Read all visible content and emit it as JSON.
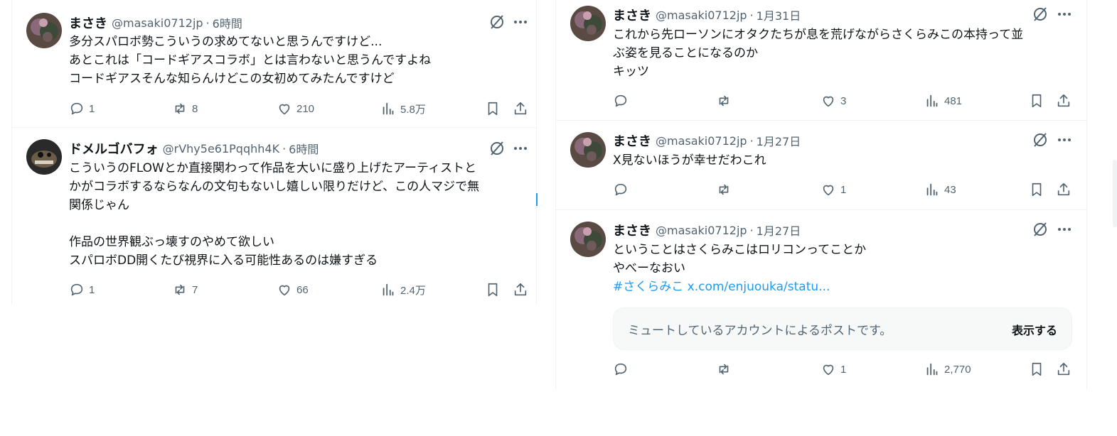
{
  "left_tweets": [
    {
      "name": "まさき",
      "handle": "@masaki0712jp",
      "sep": "·",
      "time": "6時間",
      "lines": [
        "多分スパロボ勢こういうの求めてないと思うんですけど...",
        "あとこれは「コードギアスコラボ」とは言わないと思うんですよね",
        "コードギアスそんな知らんけどこの女初めてみたんですけど"
      ],
      "replies": "1",
      "reposts": "8",
      "likes": "210",
      "views": "5.8万"
    },
    {
      "name": "ドメルゴバフォ",
      "handle": "@rVhy5e61Pqqhh4K",
      "sep": "·",
      "time": "6時間",
      "lines": [
        "こういうのFLOWとか直接関わって作品を大いに盛り上げたアーティストと",
        "かがコラボするならなんの文句もないし嬉しい限りだけど、この人マジで無",
        "関係じゃん",
        "",
        "作品の世界観ぶっ壊すのやめて欲しい",
        "スパロボDD開くたび視界に入る可能性あるのは嫌すぎる"
      ],
      "replies": "1",
      "reposts": "7",
      "likes": "66",
      "views": "2.4万"
    }
  ],
  "right_tweets": [
    {
      "name": "まさき",
      "handle": "@masaki0712jp",
      "sep": "·",
      "time": "1月31日",
      "lines": [
        "これから先ローソンにオタクたちが息を荒げながらさくらみこの本持って並",
        "ぶ姿を見ることになるのか",
        "キッツ"
      ],
      "replies": "",
      "reposts": "",
      "likes": "3",
      "views": "481"
    },
    {
      "name": "まさき",
      "handle": "@masaki0712jp",
      "sep": "·",
      "time": "1月27日",
      "lines": [
        "X見ないほうが幸せだわこれ"
      ],
      "replies": "",
      "reposts": "",
      "likes": "1",
      "views": "43"
    },
    {
      "name": "まさき",
      "handle": "@masaki0712jp",
      "sep": "·",
      "time": "1月27日",
      "lines": [
        "ということはさくらみこはロリコンってことか",
        "やべーなおい"
      ],
      "link_hashtag": "#さくらみこ",
      "link_url": "x.com/enjuouka/statu...",
      "muted_text": "ミュートしているアカウントによるポストです。",
      "show_label": "表示する",
      "replies": "",
      "reposts": "",
      "likes": "1",
      "views": "2,770"
    }
  ],
  "icons": [
    "grok-icon",
    "more-icon",
    "reply-icon",
    "repost-icon",
    "like-icon",
    "views-icon",
    "bookmark-icon",
    "share-icon"
  ],
  "colors": {
    "text": "#0f1419",
    "secondary": "#536471",
    "link": "#1d9bf0",
    "border": "#eff3f4"
  }
}
